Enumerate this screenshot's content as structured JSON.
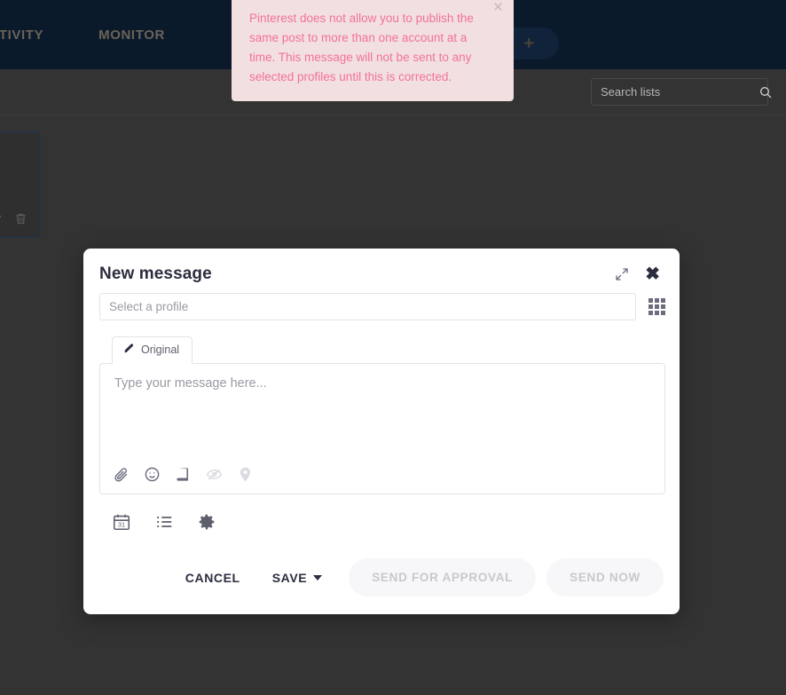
{
  "topnav": {
    "items": [
      {
        "label": "ACTIVITY",
        "name": "activity"
      },
      {
        "label": "MONITOR",
        "name": "monitor"
      }
    ],
    "compose_button_label": "+"
  },
  "subheader": {
    "search_placeholder": "Search lists",
    "search_value": "",
    "search_icon": "search-icon"
  },
  "alert": {
    "message": "Pinterest does not allow you to publish the same post to more than one account at a time. This message will not be sent to any selected profiles until this is corrected.",
    "close_label": "×",
    "background_color": "#f2dfe0",
    "text_color": "#f2729a"
  },
  "background_card": {
    "edit_icon": "pencil-icon",
    "delete_icon": "trash-icon"
  },
  "modal": {
    "title": "New message",
    "expand_icon": "expand-icon",
    "close_icon": "close-icon",
    "profile": {
      "placeholder": "Select a profile",
      "value": "",
      "grid_icon": "grid-icon"
    },
    "tabs": [
      {
        "label": "Original",
        "icon": "pencil-icon",
        "active": true
      }
    ],
    "composer": {
      "placeholder": "Type your message here...",
      "value": "",
      "tools": [
        {
          "name": "attachment-icon",
          "label": "Attach file",
          "disabled": false
        },
        {
          "name": "emoji-icon",
          "label": "Insert emoji",
          "disabled": false
        },
        {
          "name": "library-icon",
          "label": "Content library",
          "disabled": false
        },
        {
          "name": "hidden-eye-icon",
          "label": "Preview hidden",
          "disabled": true
        },
        {
          "name": "location-pin-icon",
          "label": "Add location",
          "disabled": true
        }
      ]
    },
    "secondary_tools": [
      {
        "name": "calendar-icon",
        "label": "Schedule",
        "day": "31"
      },
      {
        "name": "list-icon",
        "label": "Add to list"
      },
      {
        "name": "gear-icon",
        "label": "Message settings"
      }
    ],
    "footer": {
      "cancel_label": "CANCEL",
      "save_label": "SAVE",
      "send_for_approval_label": "SEND FOR APPROVAL",
      "send_now_label": "SEND NOW",
      "send_disabled": true
    }
  },
  "colors": {
    "nav_background": "#0b1a2b",
    "page_background": "#333333",
    "modal_background": "#ffffff",
    "accent_pink": "#f2729a",
    "title_color": "#2c2d3f"
  }
}
